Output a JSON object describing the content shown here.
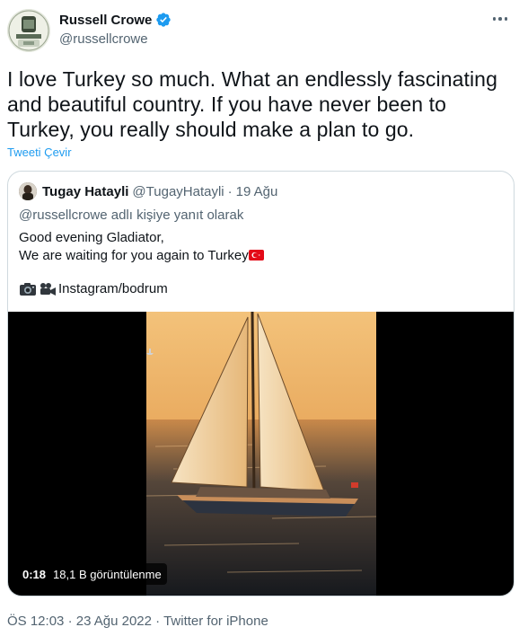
{
  "author": {
    "display_name": "Russell Crowe",
    "handle": "@russellcrowe"
  },
  "tweet": {
    "text": "I love Turkey so much. What an endlessly fascinating and beautiful country. If you have never been to Turkey, you really should make a plan to go.",
    "translate_label": "Tweeti Çevir"
  },
  "quote": {
    "display_name": "Tugay Hatayli",
    "handle": "@TugayHatayli",
    "separator": "·",
    "date": "19 Ağu",
    "reply_context": "@russellcrowe adlı kişiye yanıt olarak",
    "line1": "Good evening Gladiator,",
    "line2": "We are waiting for you again to Turkey",
    "insta": "Instagram/bodrum",
    "video": {
      "duration": "0:18",
      "views": "18,1 B görüntülenme"
    }
  },
  "footer": {
    "time": "ÖS 12:03",
    "sep1": "·",
    "date": "23 Ağu 2022",
    "sep2": "·",
    "source": "Twitter for iPhone"
  },
  "colors": {
    "accent": "#1d9bf0",
    "secondary_text": "#536471",
    "border": "#cfd9de"
  },
  "icons": [
    "verified-badge-icon",
    "more-options-icon",
    "camera-icon",
    "movie-camera-icon",
    "turkey-flag-icon"
  ]
}
